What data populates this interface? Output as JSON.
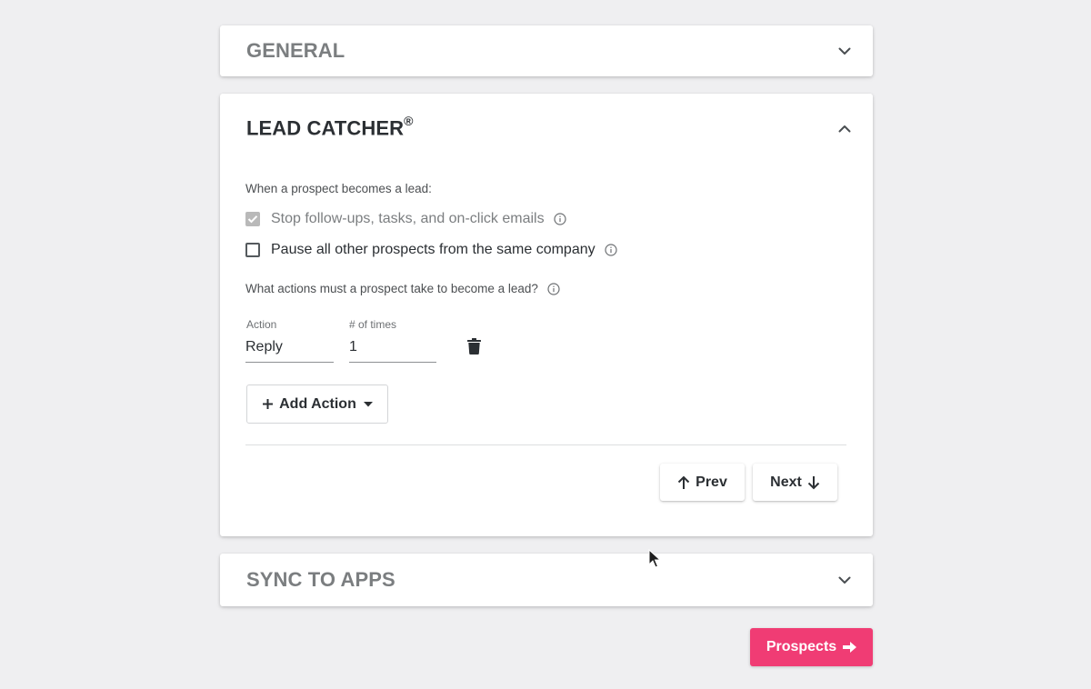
{
  "colors": {
    "background": "#efeff1",
    "panel": "#ffffff",
    "accent": "#f03c74",
    "text_dark": "#2b2f33",
    "text_muted": "#7b7e80"
  },
  "general": {
    "title": "GENERAL",
    "icon": "chevron-down-icon"
  },
  "lead_catcher": {
    "title": "LEAD CATCHER",
    "trademark": "®",
    "icon": "chevron-up-icon",
    "when_label": "When a prospect becomes a lead:",
    "options": [
      {
        "label": "Stop follow-ups, tasks, and on-click emails",
        "checked": true,
        "disabled": true
      },
      {
        "label": "Pause all other prospects from the same company",
        "checked": false,
        "disabled": false
      }
    ],
    "actions_question": "What actions must a prospect take to become a lead?",
    "action_label": "Action",
    "times_label": "# of times",
    "action_value": "Reply",
    "times_value": "1",
    "add_action_label": "Add Action",
    "prev_label": "Prev",
    "next_label": "Next"
  },
  "sync": {
    "title": "SYNC TO APPS",
    "icon": "chevron-down-icon"
  },
  "footer": {
    "prospects_label": "Prospects"
  }
}
